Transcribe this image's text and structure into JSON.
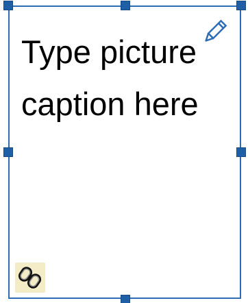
{
  "caption": {
    "placeholder_text": "Type picture caption here"
  },
  "icons": {
    "edit": "pencil-icon",
    "link": "link-icon"
  },
  "colors": {
    "frame_border": "#2e6db4",
    "handle_fill": "#1f5fa5",
    "link_button_bg": "#f3ecc6"
  }
}
